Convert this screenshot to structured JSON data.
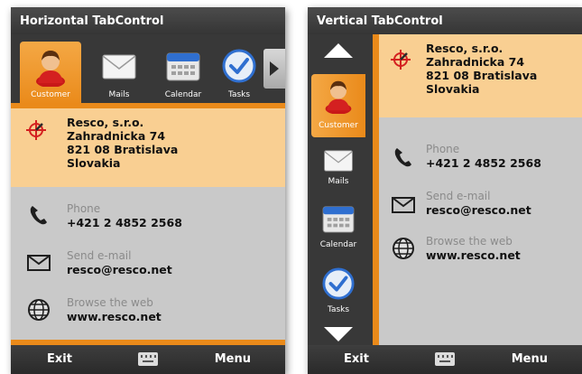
{
  "colors": {
    "accent": "#ea8a1a",
    "address_bg": "#f9cf92",
    "panel_bg": "#c9c9c9",
    "chrome": "#383838"
  },
  "horizontal": {
    "title": "Horizontal TabControl",
    "tabs": [
      {
        "label": "Customer",
        "icon": "customer-icon",
        "selected": true
      },
      {
        "label": "Mails",
        "icon": "mail-icon",
        "selected": false
      },
      {
        "label": "Calendar",
        "icon": "calendar-icon",
        "selected": false
      },
      {
        "label": "Tasks",
        "icon": "tasks-icon",
        "selected": false
      }
    ],
    "address": [
      "Resco, s.r.o.",
      "Zahradnicka 74",
      "821 08 Bratislava",
      "Slovakia"
    ],
    "phone": {
      "label": "Phone",
      "value": "+421 2 4852 2568"
    },
    "email": {
      "label": "Send e-mail",
      "value": "resco@resco.net"
    },
    "web": {
      "label": "Browse the web",
      "value": "www.resco.net"
    },
    "menubar": {
      "left": "Exit",
      "right": "Menu"
    }
  },
  "vertical": {
    "title": "Vertical TabControl",
    "tabs": [
      {
        "label": "Customer",
        "icon": "customer-icon",
        "selected": true
      },
      {
        "label": "Mails",
        "icon": "mail-icon",
        "selected": false
      },
      {
        "label": "Calendar",
        "icon": "calendar-icon",
        "selected": false
      },
      {
        "label": "Tasks",
        "icon": "tasks-icon",
        "selected": false
      }
    ],
    "address": [
      "Resco, s.r.o.",
      "Zahradnicka 74",
      "821 08 Bratislava",
      "Slovakia"
    ],
    "phone": {
      "label": "Phone",
      "value": "+421 2 4852 2568"
    },
    "email": {
      "label": "Send e-mail",
      "value": "resco@resco.net"
    },
    "web": {
      "label": "Browse the web",
      "value": "www.resco.net"
    },
    "menubar": {
      "left": "Exit",
      "right": "Menu"
    }
  }
}
